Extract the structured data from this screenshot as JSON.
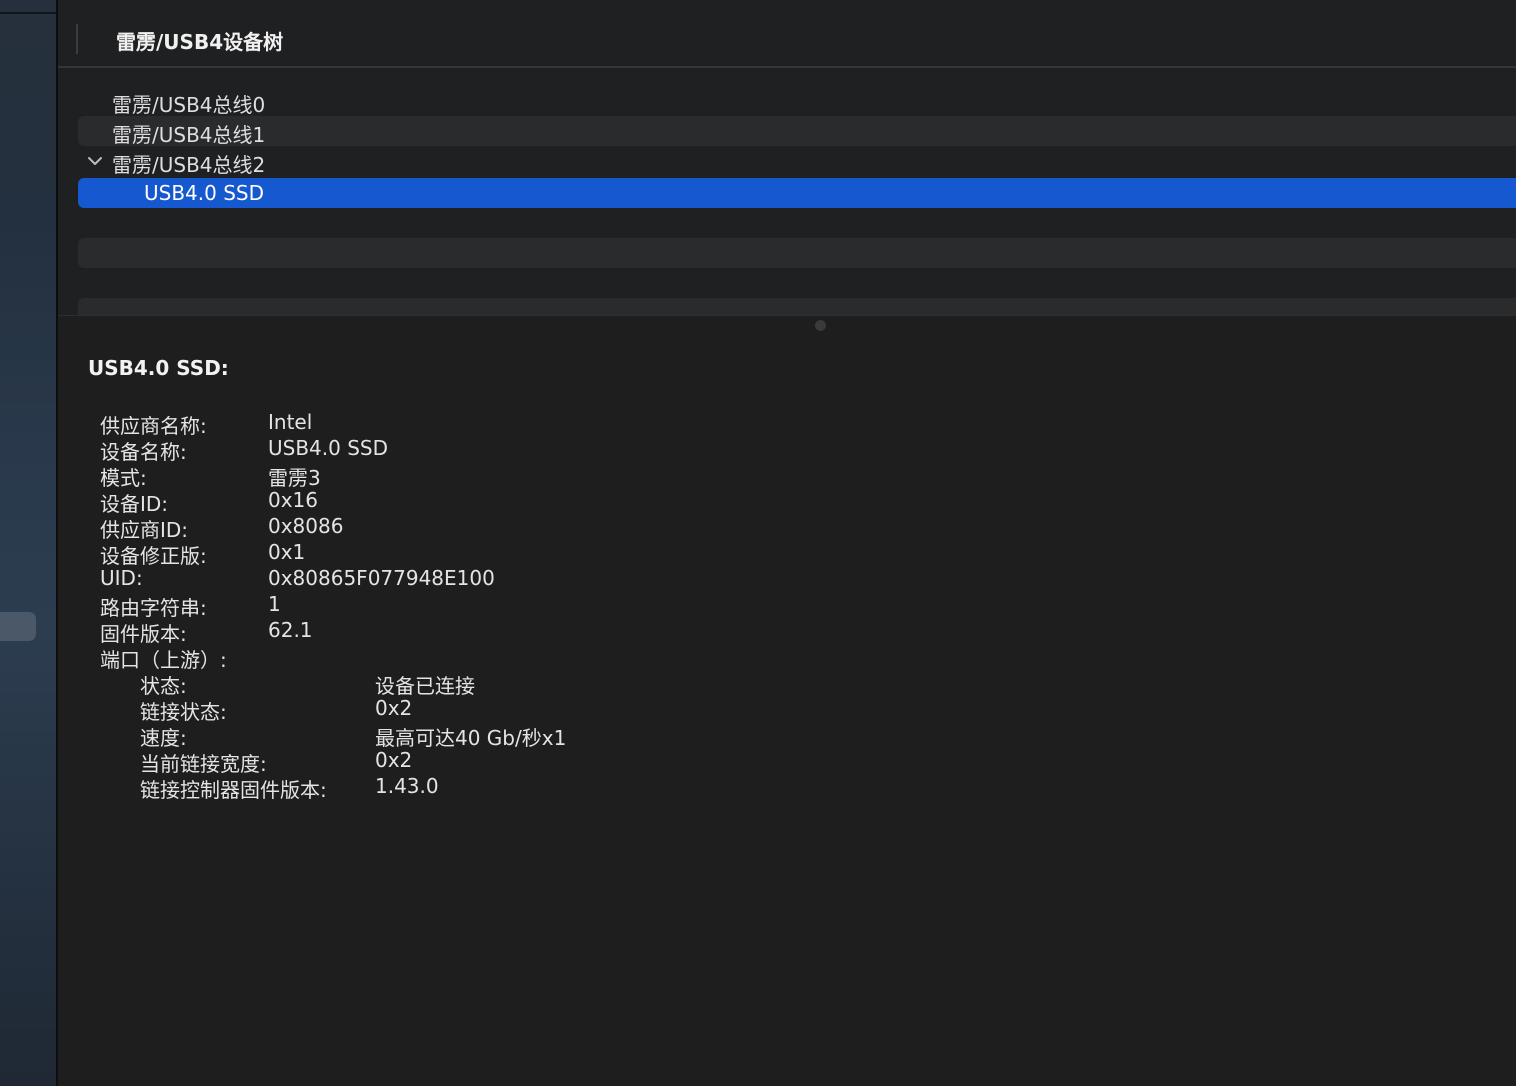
{
  "tree": {
    "title": "雷雳/USB4设备树",
    "rows": [
      {
        "label": "雷雳/USB4总线0"
      },
      {
        "label": "雷雳/USB4总线1"
      },
      {
        "label": "雷雳/USB4总线2",
        "expanded": true
      },
      {
        "label": "USB4.0 SSD",
        "selected": true
      }
    ]
  },
  "details": {
    "title": "USB4.0 SSD:",
    "fields": [
      {
        "key": "供应商名称:",
        "value": "Intel"
      },
      {
        "key": "设备名称:",
        "value": "USB4.0 SSD"
      },
      {
        "key": "模式:",
        "value": "雷雳3"
      },
      {
        "key": "设备ID:",
        "value": "0x16"
      },
      {
        "key": "供应商ID:",
        "value": "0x8086"
      },
      {
        "key": "设备修正版:",
        "value": "0x1"
      },
      {
        "key": "UID:",
        "value": "0x80865F077948E100"
      },
      {
        "key": "路由字符串:",
        "value": "1"
      },
      {
        "key": "固件版本:",
        "value": "62.1"
      },
      {
        "key": "端口（上游）:",
        "value": ""
      }
    ],
    "port": [
      {
        "key": "状态:",
        "value": "设备已连接"
      },
      {
        "key": "链接状态:",
        "value": "0x2"
      },
      {
        "key": "速度:",
        "value": "最高可达40 Gb/秒x1"
      },
      {
        "key": "当前链接宽度:",
        "value": "0x2"
      },
      {
        "key": "链接控制器固件版本:",
        "value": "1.43.0"
      }
    ]
  },
  "colors": {
    "selection": "#1558cf",
    "background": "#1e1e1e"
  }
}
